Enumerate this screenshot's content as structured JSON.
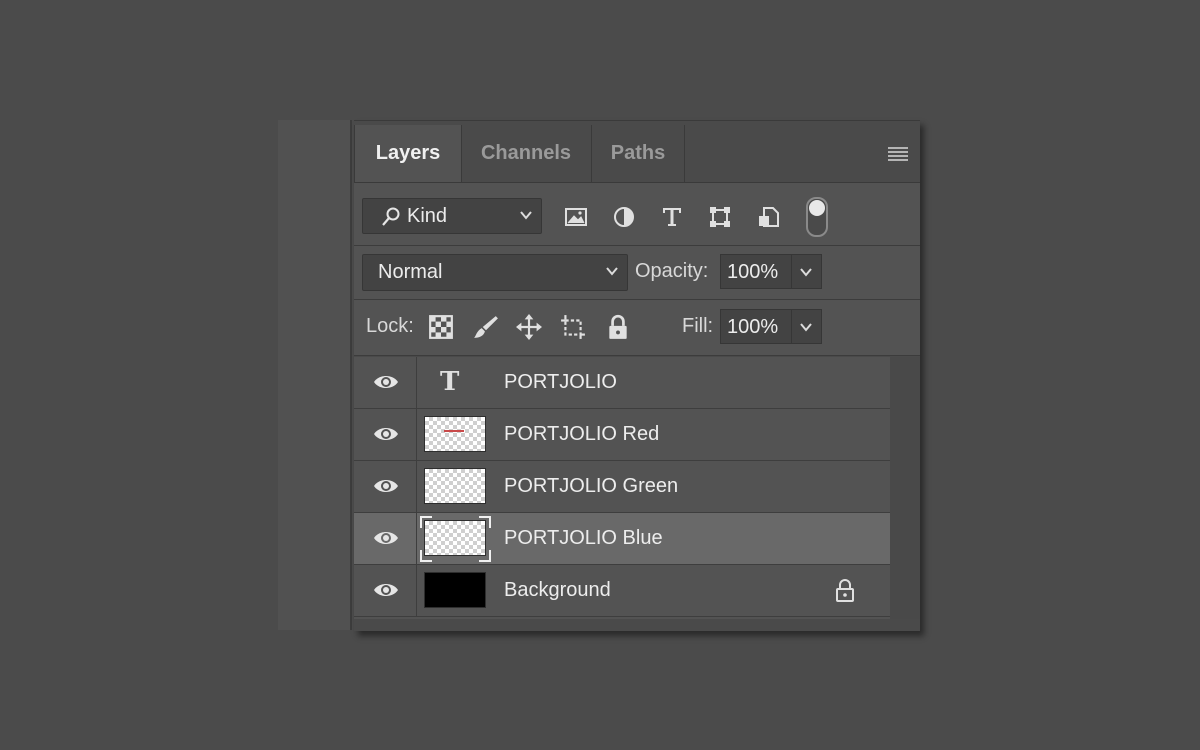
{
  "tabs": [
    {
      "label": "Layers",
      "active": true
    },
    {
      "label": "Channels",
      "active": false
    },
    {
      "label": "Paths",
      "active": false
    }
  ],
  "filter": {
    "kind_label": "Kind",
    "icons": [
      "image-filter-icon",
      "adjustment-filter-icon",
      "type-filter-icon",
      "shape-filter-icon",
      "smart-object-filter-icon"
    ]
  },
  "blend": {
    "mode": "Normal",
    "opacity_label": "Opacity:",
    "opacity_value": "100%"
  },
  "lock": {
    "label": "Lock:",
    "fill_label": "Fill:",
    "fill_value": "100%"
  },
  "layers": [
    {
      "name": "PORTJOLIO",
      "type": "text",
      "selected": false,
      "locked": false
    },
    {
      "name": "PORTJOLIO Red",
      "type": "pixel",
      "selected": false,
      "locked": false
    },
    {
      "name": "PORTJOLIO Green",
      "type": "pixel",
      "selected": false,
      "locked": false
    },
    {
      "name": "PORTJOLIO Blue",
      "type": "pixel",
      "selected": true,
      "locked": false
    },
    {
      "name": "Background",
      "type": "fill-black",
      "selected": false,
      "locked": true
    }
  ],
  "colors": {
    "app_bg": "#4b4b4b",
    "panel_bg": "#535353",
    "selected_row": "#696969",
    "text": "#ededed"
  }
}
